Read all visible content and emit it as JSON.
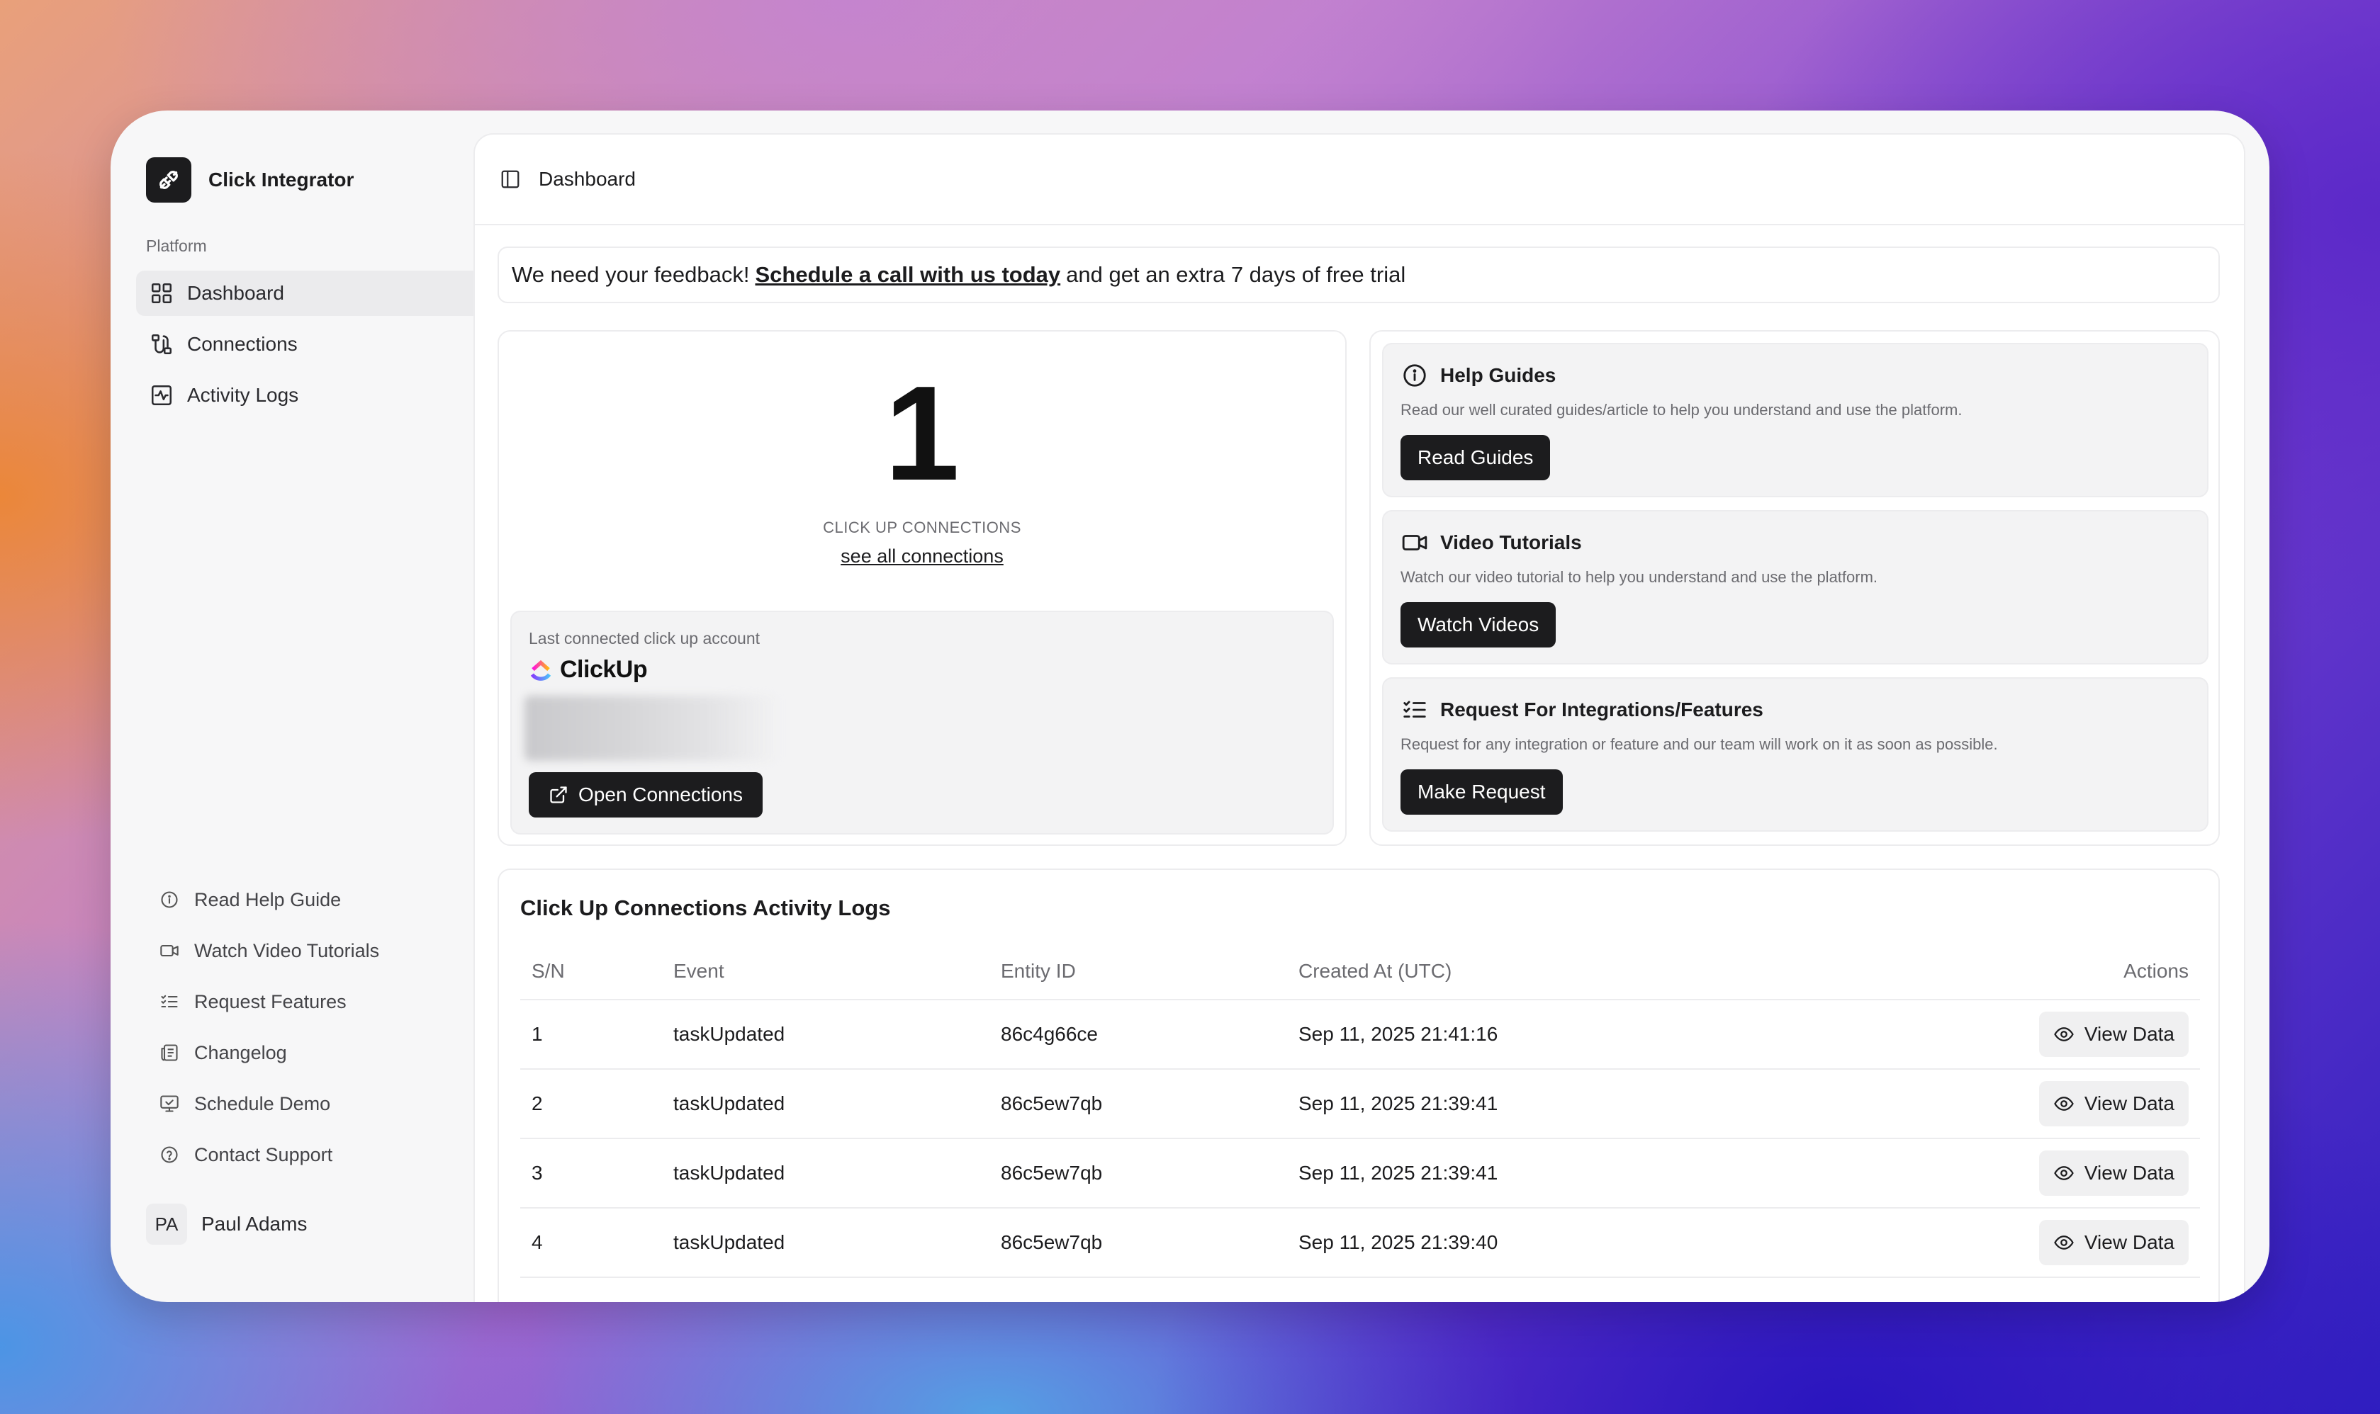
{
  "app": {
    "name": "Click Integrator"
  },
  "sidebar": {
    "section_label": "Platform",
    "nav": [
      {
        "label": "Dashboard",
        "icon": "grid-icon",
        "active": true
      },
      {
        "label": "Connections",
        "icon": "connection-icon",
        "active": false
      },
      {
        "label": "Activity Logs",
        "icon": "activity-icon",
        "active": false
      }
    ],
    "bottom_links": [
      {
        "label": "Read Help Guide",
        "icon": "info-icon"
      },
      {
        "label": "Watch Video Tutorials",
        "icon": "video-icon"
      },
      {
        "label": "Request Features",
        "icon": "checklist-icon"
      },
      {
        "label": "Changelog",
        "icon": "newspaper-icon"
      },
      {
        "label": "Schedule Demo",
        "icon": "monitor-icon"
      },
      {
        "label": "Contact Support",
        "icon": "help-circle-icon"
      }
    ],
    "user": {
      "initials": "PA",
      "name": "Paul Adams"
    }
  },
  "header": {
    "title": "Dashboard"
  },
  "banner": {
    "before": "We need your feedback!",
    "link": "Schedule a call with us today",
    "after": "and get an extra 7 days of free trial"
  },
  "connections_card": {
    "count": "1",
    "label": "CLICK UP CONNECTIONS",
    "see_all": "see all connections",
    "last_label": "Last connected click up account",
    "brand": "ClickUp",
    "open_button": "Open Connections"
  },
  "resources": [
    {
      "title": "Help Guides",
      "icon": "info-icon",
      "description": "Read our well curated guides/article to help you understand and use the platform.",
      "button": "Read Guides"
    },
    {
      "title": "Video Tutorials",
      "icon": "video-icon",
      "description": "Watch our video tutorial to help you understand and use the platform.",
      "button": "Watch Videos"
    },
    {
      "title": "Request For Integrations/Features",
      "icon": "checklist-icon",
      "description": "Request for any integration or feature and our team will work on it as soon as possible.",
      "button": "Make Request"
    }
  ],
  "activity": {
    "title": "Click Up Connections Activity Logs",
    "columns": {
      "sn": "S/N",
      "event": "Event",
      "entity": "Entity ID",
      "created": "Created At (UTC)",
      "actions": "Actions"
    },
    "rows": [
      {
        "sn": "1",
        "event": "taskUpdated",
        "entity": "86c4g66ce",
        "created": "Sep 11, 2025 21:41:16",
        "action": "View Data"
      },
      {
        "sn": "2",
        "event": "taskUpdated",
        "entity": "86c5ew7qb",
        "created": "Sep 11, 2025 21:39:41",
        "action": "View Data"
      },
      {
        "sn": "3",
        "event": "taskUpdated",
        "entity": "86c5ew7qb",
        "created": "Sep 11, 2025 21:39:41",
        "action": "View Data"
      },
      {
        "sn": "4",
        "event": "taskUpdated",
        "entity": "86c5ew7qb",
        "created": "Sep 11, 2025 21:39:40",
        "action": "View Data"
      }
    ]
  },
  "colors": {
    "dark": "#1c1c1e",
    "muted": "#6b6b70",
    "active_bg": "#ebebed"
  }
}
